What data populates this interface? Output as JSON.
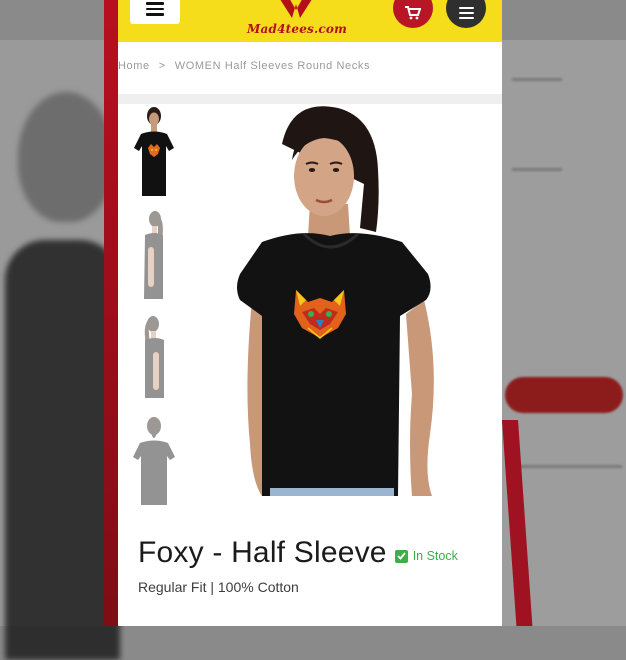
{
  "header": {
    "brand_name": "Mad4tees.com",
    "icons": [
      "menu-icon",
      "cart-icon",
      "menu-icon"
    ]
  },
  "breadcrumb": {
    "home": "Home",
    "separator": ">",
    "current": "WOMEN Half Sleeves Round Necks"
  },
  "product": {
    "title": "Foxy - Half Sleeve",
    "stock_status": "In Stock",
    "subtitle": "Regular Fit | 100% Cotton",
    "thumbnail_count": 4
  },
  "colors": {
    "header_yellow": "#f5dd1c",
    "brand_red": "#b4101c",
    "stock_green": "#3fae49",
    "tee_black": "#111111"
  }
}
